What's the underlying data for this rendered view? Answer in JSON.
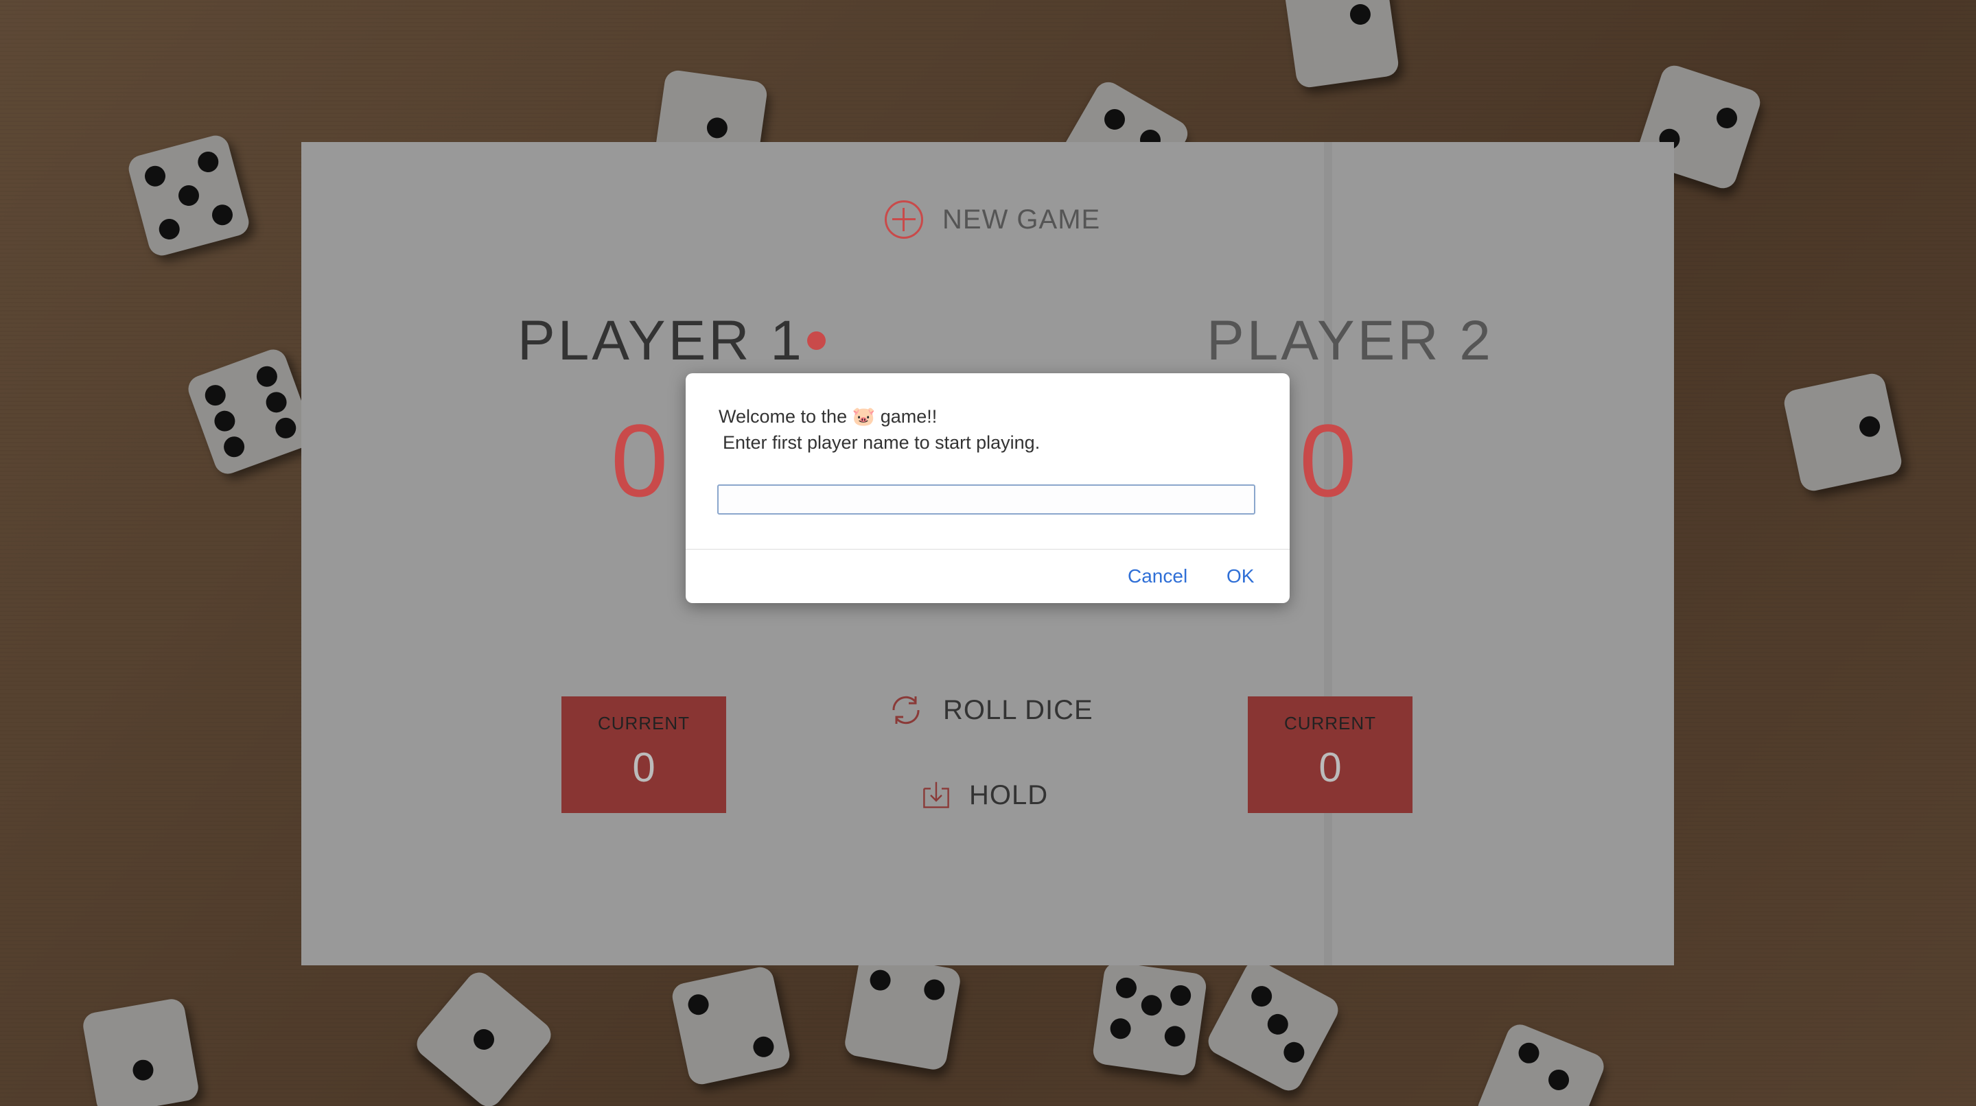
{
  "game": {
    "new_game_label": "NEW GAME",
    "player1": {
      "name": "PLAYER 1",
      "score": "0",
      "current_label": "CURRENT",
      "current_value": "0"
    },
    "player2": {
      "name": "PLAYER 2",
      "score": "0",
      "current_label": "CURRENT",
      "current_value": "0"
    },
    "roll_label": "ROLL DICE",
    "hold_label": "HOLD"
  },
  "dialog": {
    "line1_prefix": "Welcome to the ",
    "emoji": "🐷",
    "line1_suffix": "game!!",
    "line2": "Enter first player name to start playing.",
    "input_value": "",
    "cancel_label": "Cancel",
    "ok_label": "OK"
  },
  "colors": {
    "accent": "#c94a4a",
    "link": "#2f6fd6"
  },
  "icons": [
    "plus-circle-icon",
    "refresh-icon",
    "download-icon",
    "pig-emoji-icon"
  ]
}
